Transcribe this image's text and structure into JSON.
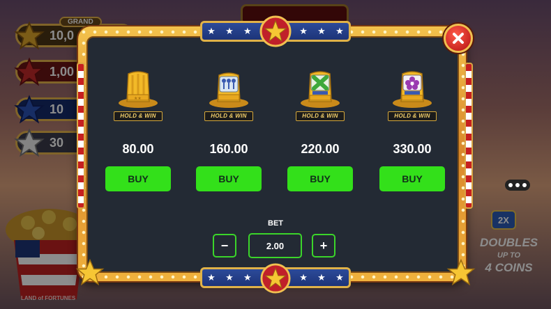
{
  "background": {
    "jackpots": [
      {
        "tag": "GRAND",
        "amount": "10,0",
        "color": "#d6a23a"
      },
      {
        "tag": "",
        "amount": "1,00",
        "color": "#c42a2a"
      },
      {
        "tag": "",
        "amount": "10",
        "color": "#2a52b5"
      },
      {
        "tag": "",
        "amount": "30",
        "color": "#e8e2d6"
      }
    ],
    "multiplier_badge": "2X",
    "promo_text_line1": "DOUBLES",
    "promo_text_line2": "UP TO",
    "promo_text_line3": "4 COINS",
    "logo_text": "LAND of FORTUNES"
  },
  "dialog": {
    "items": [
      {
        "hat_icon": "gold-hat-icon",
        "badge": "HOLD & WIN",
        "price": "80.00",
        "buy_label": "BUY"
      },
      {
        "hat_icon": "keys-hat-icon",
        "badge": "HOLD & WIN",
        "price": "160.00",
        "buy_label": "BUY"
      },
      {
        "hat_icon": "cross-hat-icon",
        "badge": "HOLD & WIN",
        "price": "220.00",
        "buy_label": "BUY"
      },
      {
        "hat_icon": "flower-hat-icon",
        "badge": "HOLD & WIN",
        "price": "330.00",
        "buy_label": "BUY"
      }
    ],
    "bet": {
      "label": "BET",
      "value": "2.00",
      "minus": "−",
      "plus": "+"
    },
    "close_icon": "close-icon"
  },
  "colors": {
    "buy_green": "#33e01a",
    "panel": "#232a34",
    "frame_gold": "#e9a93c",
    "close_red": "#c81a14"
  }
}
